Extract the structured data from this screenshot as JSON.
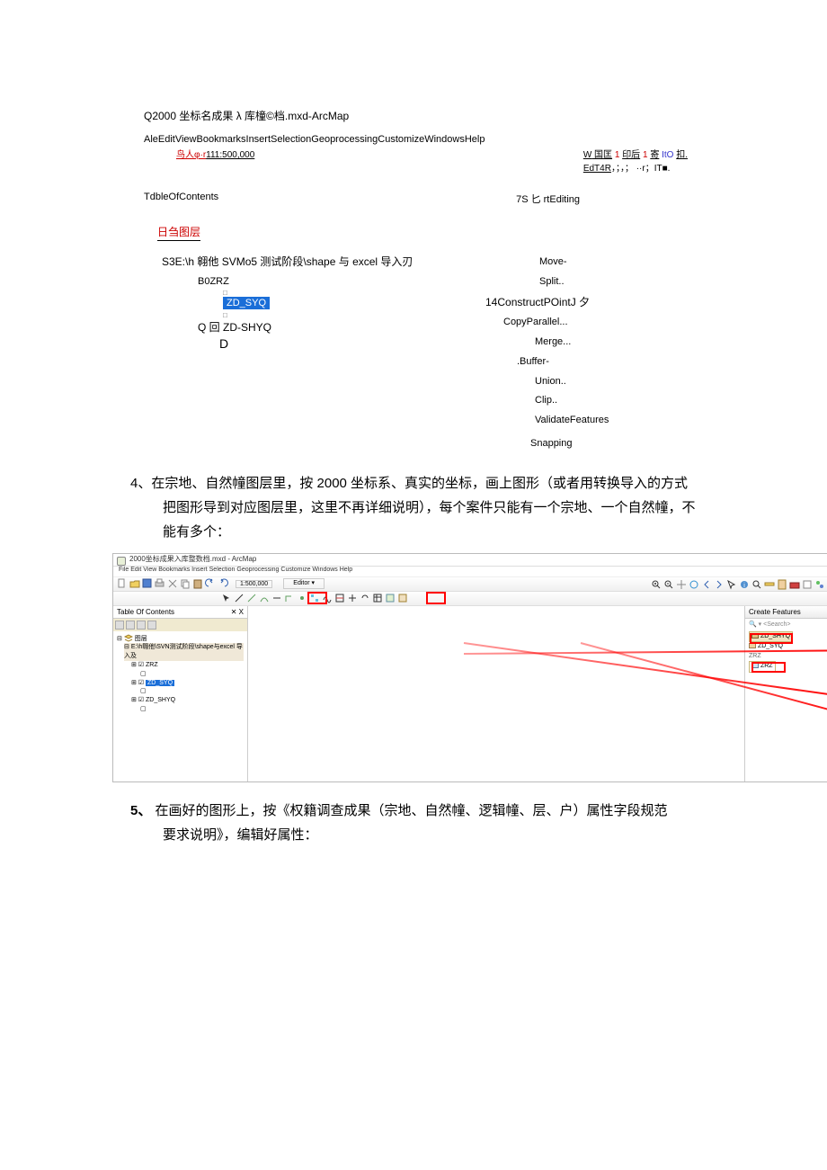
{
  "title_line": "Q2000 坐标名成果 λ 库橦©档.mxd-ArcMap",
  "menu_line": "AleEditViewBookmarksInsertSelectionGeoprocessingCustomizeWindowsHelp",
  "scale_line": {
    "prefix": "鸟人φ·r",
    "scale": "111:500,000"
  },
  "top_right1": {
    "w": "W",
    "mid": " 国匡",
    "one1": "1",
    "a": "印后",
    "one2": "1",
    "b": "寄",
    "c": "ItO",
    "d": "扣."
  },
  "top_right2": {
    "a": "EdT4R",
    "b": "，；，；   ··r；IT■."
  },
  "toc_label": "TdbleOfContents",
  "start_editing": "7S 匕 rtEditing",
  "layers_header": "日刍图层",
  "path_line": "S3E:\\h 翱他 SVMo5 测试阶段\\shape 与 excel 导入刃",
  "tree": {
    "b0zrz": "B0ZRZ",
    "zd_syq": "ZD_SYQ",
    "zd_shyq_prefix": "Q 回 ",
    "zd_shyq": "ZD-SHYQ",
    "d": "D"
  },
  "menu_items": [
    "Move-",
    "Split..",
    "14ConstructPOintJ 夕",
    "CopyParallel...",
    "Merge...",
    ".Buffer-",
    "Union..",
    "Clip..",
    "ValidateFeatures",
    "Snapping"
  ],
  "para4": {
    "num": "4、",
    "l1": "在宗地、自然幢图层里，按 2000 坐标系、真实的坐标，画上图形（或者用转换导入的方式",
    "l2": "把图形导到对应图层里，这里不再详细说明），每个案件只能有一个宗地、一个自然幢，不",
    "l3": "能有多个："
  },
  "ss": {
    "title": "2000坐标成果入库整数档.mxd - ArcMap",
    "menu": "File  Edit  View  Bookmarks  Insert  Selection  Geoprocessing  Customize  Windows  Help",
    "scale": "1:500,000",
    "editor_label": "Editor ▾",
    "toc_header": "Table Of Contents",
    "toc_close": "✕ X",
    "layers": "图层",
    "path": "E:\\h翱他\\SVN测试阶段\\shape与excel 导入及",
    "zrz": "ZRZ",
    "zd_syq": "ZD_SYQ",
    "zd_shyq": "ZD_SHYQ",
    "create_header": "Create Features",
    "search_ph": "<Search>",
    "c_items": [
      "ZD_SHYQ",
      "ZD_SYQ",
      "ZRZ",
      "ZRZ"
    ]
  },
  "para5": {
    "num": "5、",
    "l1": " 在画好的图形上，按《权籍调查成果（宗地、自然幢、逻辑幢、层、户）属性字段规范",
    "l2": "要求说明》，编辑好属性："
  }
}
